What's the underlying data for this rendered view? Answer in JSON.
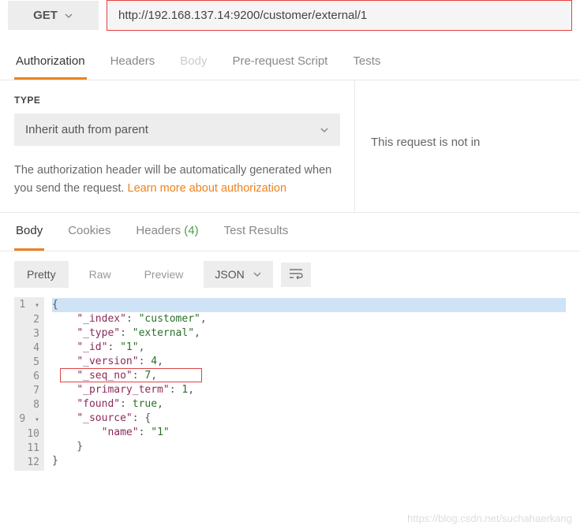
{
  "request": {
    "method": "GET",
    "url": "http://192.168.137.14:9200/customer/external/1"
  },
  "requestTabs": {
    "authorization": "Authorization",
    "headers": "Headers",
    "body": "Body",
    "prerequest": "Pre-request Script",
    "tests": "Tests"
  },
  "auth": {
    "typeLabel": "TYPE",
    "selected": "Inherit auth from parent",
    "description1": "The authorization header will be automatically generated when you send the request. ",
    "linkText": "Learn more about authorization"
  },
  "rightPanel": {
    "message": "This request is not in"
  },
  "responseTabs": {
    "body": "Body",
    "cookies": "Cookies",
    "headers": "Headers",
    "headersCount": "(4)",
    "testResults": "Test Results"
  },
  "responseToolbar": {
    "pretty": "Pretty",
    "raw": "Raw",
    "preview": "Preview",
    "lang": "JSON"
  },
  "chart_data": {
    "type": "table",
    "title": "JSON response body",
    "rows": [
      {
        "key": "_index",
        "value": "customer",
        "type": "string"
      },
      {
        "key": "_type",
        "value": "external",
        "type": "string"
      },
      {
        "key": "_id",
        "value": "1",
        "type": "string"
      },
      {
        "key": "_version",
        "value": 4,
        "type": "number"
      },
      {
        "key": "_seq_no",
        "value": 7,
        "type": "number",
        "highlighted": true
      },
      {
        "key": "_primary_term",
        "value": 1,
        "type": "number"
      },
      {
        "key": "found",
        "value": true,
        "type": "boolean"
      },
      {
        "key": "_source",
        "value": {
          "name": "1"
        },
        "type": "object"
      }
    ]
  },
  "code": {
    "lines": [
      "1",
      "2",
      "3",
      "4",
      "5",
      "6",
      "7",
      "8",
      "9",
      "10",
      "11",
      "12"
    ],
    "l1": "{",
    "l2k": "\"_index\"",
    "l2v": "\"customer\"",
    "l3k": "\"_type\"",
    "l3v": "\"external\"",
    "l4k": "\"_id\"",
    "l4v": "\"1\"",
    "l5k": "\"_version\"",
    "l5v": "4",
    "l6k": "\"_seq_no\"",
    "l6v": "7",
    "l7k": "\"_primary_term\"",
    "l7v": "1",
    "l8k": "\"found\"",
    "l8v": "true",
    "l9k": "\"_source\"",
    "l10k": "\"name\"",
    "l10v": "\"1\"",
    "l11": "    }",
    "l12": "}"
  },
  "watermark": "https://blog.csdn.net/suchahaerkang"
}
